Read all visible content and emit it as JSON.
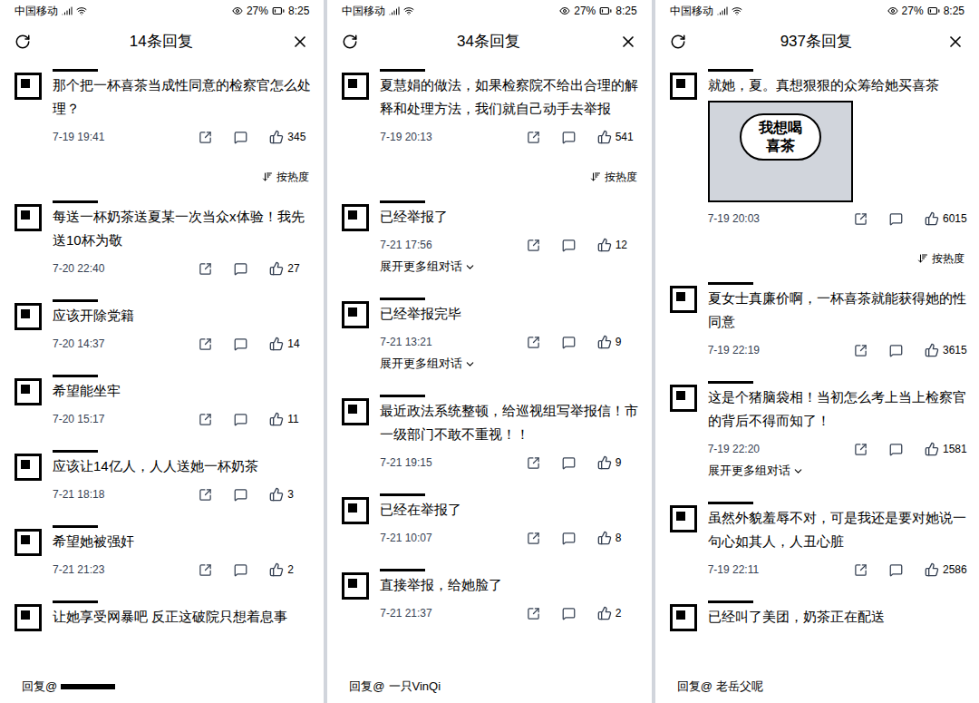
{
  "panels": [
    {
      "status": {
        "carrier": "中国移动",
        "battery": "27%",
        "time": "8:25"
      },
      "title": "14条回复",
      "sort": "按热度",
      "reply": {
        "prefix": "回复@",
        "name": ""
      },
      "comments": [
        {
          "text": "那个把一杯喜茶当成性同意的检察官怎么处理？",
          "date": "7-19 19:41",
          "likes": "345"
        },
        {
          "text": "每送一杯奶茶送夏某一次当众x体验！我先送10杯为敬",
          "date": "7-20 22:40",
          "likes": "27"
        },
        {
          "text": "应该开除党籍",
          "date": "7-20 14:37",
          "likes": "14"
        },
        {
          "text": "希望能坐牢",
          "date": "7-20 15:17",
          "likes": "11"
        },
        {
          "text": "应该让14亿人，人人送她一杯奶茶",
          "date": "7-21 18:18",
          "likes": "3"
        },
        {
          "text": "希望她被强奸",
          "date": "7-21 21:23",
          "likes": "2"
        },
        {
          "text": "让她享受网暴吧 反正这破院只想着息事"
        }
      ]
    },
    {
      "status": {
        "carrier": "中国移动",
        "battery": "27%",
        "time": "8:25"
      },
      "title": "34条回复",
      "sort": "按热度",
      "reply": {
        "prefix": "回复@",
        "name": "一只VinQi"
      },
      "comments": [
        {
          "text": "夏慧娟的做法，如果检察院不给出合理的解释和处理方法，我们就自己动手去举报",
          "date": "7-19 20:13",
          "likes": "541"
        },
        {
          "text": "已经举报了",
          "date": "7-21 17:56",
          "likes": "12",
          "expand": "展开更多组对话"
        },
        {
          "text": "已经举报完毕",
          "date": "7-21 13:21",
          "likes": "9",
          "expand": "展开更多组对话"
        },
        {
          "text": "最近政法系统整顿，给巡视组写举报信！市一级部门不敢不重视！！",
          "date": "7-21 19:15",
          "likes": "9"
        },
        {
          "text": "已经在举报了",
          "date": "7-21 10:07",
          "likes": "8"
        },
        {
          "text": "直接举报，给她脸了",
          "date": "7-21 21:37",
          "likes": "2"
        }
      ]
    },
    {
      "status": {
        "carrier": "中国移动",
        "battery": "27%",
        "time": "8:25"
      },
      "title": "937条回复",
      "sort": "按热度",
      "reply": {
        "prefix": "回复@",
        "name": "老岳父呢"
      },
      "comments": [
        {
          "text": "就她，夏。真想狠狠的众筹给她买喜茶",
          "picture": "我想喝喜茶",
          "date": "7-19 20:03",
          "likes": "6015"
        },
        {
          "text": "夏女士真廉价啊，一杯喜茶就能获得她的性同意",
          "date": "7-19 22:19",
          "likes": "3615"
        },
        {
          "text": "这是个猪脑袋相！当初怎么考上当上检察官的背后不得而知了！",
          "date": "7-19 22:20",
          "likes": "1581",
          "expand": "展开更多组对话"
        },
        {
          "text": "虽然外貌羞辱不对，可是我还是要对她说一句心如其人，人丑心脏",
          "date": "7-19 22:11",
          "likes": "2586"
        },
        {
          "text": "已经叫了美团，奶茶正在配送"
        }
      ]
    }
  ]
}
